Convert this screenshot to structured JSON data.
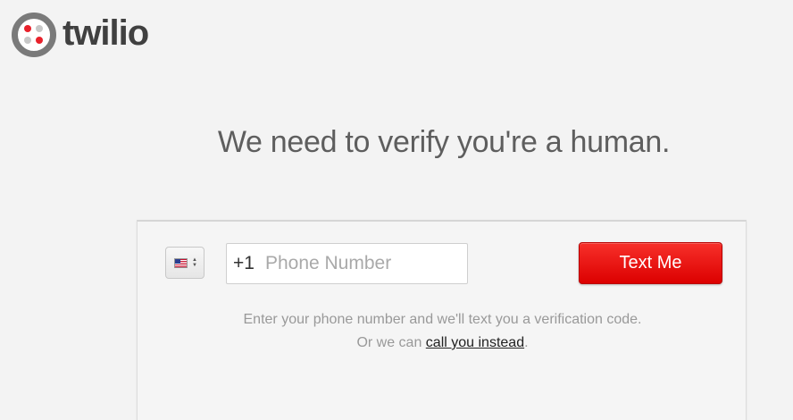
{
  "logo": {
    "text": "twilio",
    "ring_color": "#7a7a7a",
    "dot_colors": [
      "#e8212b",
      "#e8212b",
      "#c7c7c7",
      "#e8212b"
    ]
  },
  "heading": "We need to verify you're a human.",
  "form": {
    "country": {
      "selected": "United States",
      "flag_icon": "us-flag-icon"
    },
    "phone": {
      "prefix": "+1",
      "placeholder": "Phone Number",
      "value": ""
    },
    "submit_label": "Text Me",
    "accent_color": "#e81010"
  },
  "helper": {
    "line1": "Enter your phone number and we'll text you a verification code.",
    "line2_before": "Or we can ",
    "line2_link": "call you instead",
    "line2_after": "."
  }
}
